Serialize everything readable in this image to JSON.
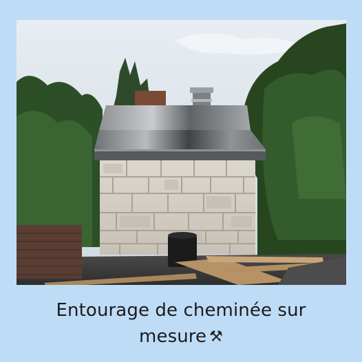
{
  "caption": {
    "line1": "Entourage de cheminée sur",
    "line2": "mesure",
    "emoji": "⚒",
    "emoji_icon": "hammer-and-pick-icon"
  },
  "colors": {
    "background": "#bfdcf7",
    "caption_text": "#1c1c1c",
    "metal_shroud": "#a9adb0",
    "stone_veneer": "#d4d0c8",
    "foliage": "#2f5a2a"
  }
}
